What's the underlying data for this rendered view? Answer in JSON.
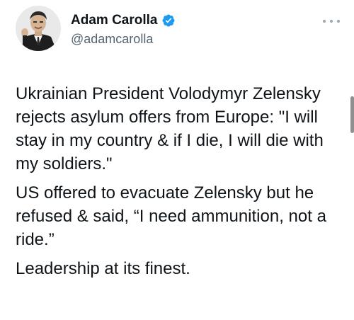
{
  "tweet": {
    "author": {
      "display_name": "Adam Carolla",
      "handle": "@adamcarolla",
      "verified": true,
      "avatar_icon": "profile-photo"
    },
    "more_icon": "more-options-icon",
    "paragraphs": [
      "Ukrainian President Volodymyr Zelensky rejects asylum offers from Europe: \"I will stay in my country & if I die, I will die with my soldiers.\"",
      "US offered to evacuate Zelensky but he refused & said, “I need ammunition, not a ride.”",
      "Leadership at its finest."
    ]
  },
  "colors": {
    "text": "#0f1419",
    "secondary": "#536471",
    "verified": "#1d9bf0"
  }
}
